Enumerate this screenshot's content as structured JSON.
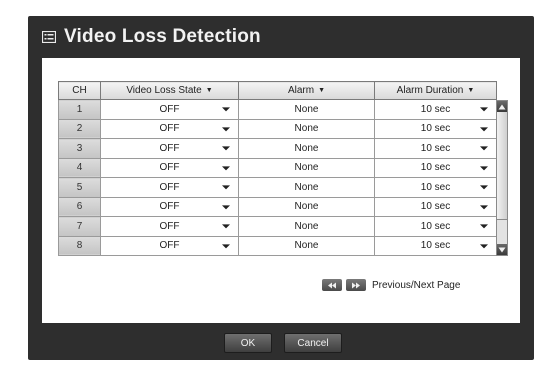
{
  "dialog": {
    "title": "Video Loss Detection",
    "icon": "list-menu-icon"
  },
  "table": {
    "headers": {
      "ch": "CH",
      "state": "Video Loss State",
      "alarm": "Alarm",
      "duration": "Alarm Duration"
    },
    "rows": [
      {
        "ch": "1",
        "state": "OFF",
        "alarm": "None",
        "duration": "10 sec"
      },
      {
        "ch": "2",
        "state": "OFF",
        "alarm": "None",
        "duration": "10 sec"
      },
      {
        "ch": "3",
        "state": "OFF",
        "alarm": "None",
        "duration": "10 sec"
      },
      {
        "ch": "4",
        "state": "OFF",
        "alarm": "None",
        "duration": "10 sec"
      },
      {
        "ch": "5",
        "state": "OFF",
        "alarm": "None",
        "duration": "10 sec"
      },
      {
        "ch": "6",
        "state": "OFF",
        "alarm": "None",
        "duration": "10 sec"
      },
      {
        "ch": "7",
        "state": "OFF",
        "alarm": "None",
        "duration": "10 sec"
      },
      {
        "ch": "8",
        "state": "OFF",
        "alarm": "None",
        "duration": "10 sec"
      }
    ]
  },
  "pager": {
    "label": "Previous/Next Page"
  },
  "buttons": {
    "ok": "OK",
    "cancel": "Cancel"
  }
}
